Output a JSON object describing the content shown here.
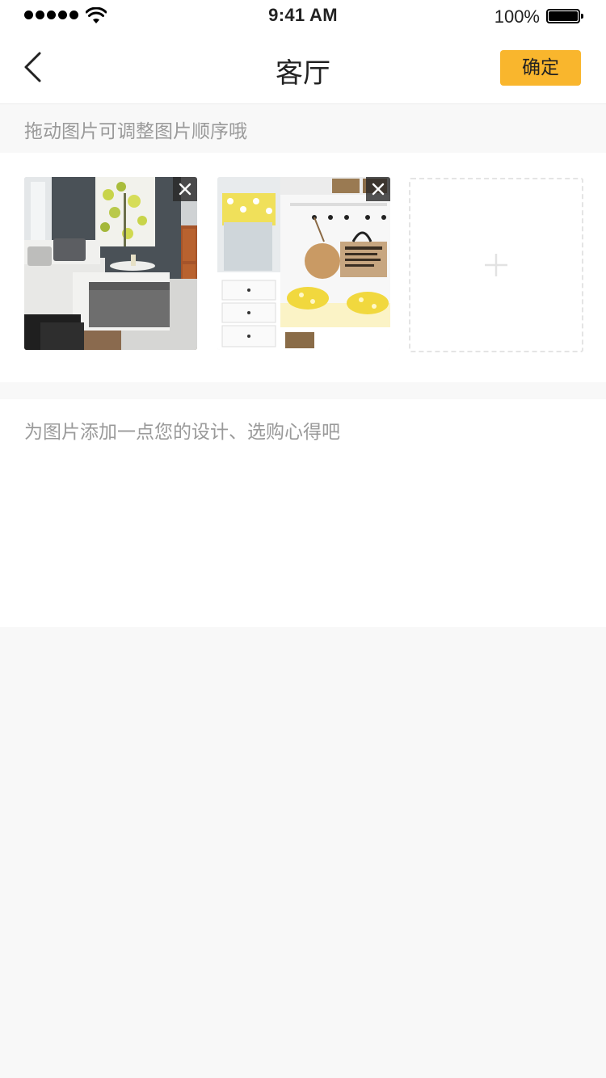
{
  "status_bar": {
    "time": "9:41 AM",
    "battery_percent": "100%",
    "signal_icon": "signal-dots-icon",
    "wifi_icon": "wifi-icon",
    "battery_icon": "battery-icon"
  },
  "nav": {
    "title": "客厅",
    "confirm_label": "确定",
    "back_icon": "chevron-left-icon"
  },
  "hint": {
    "text": "拖动图片可调整图片顺序哦"
  },
  "photos": {
    "items": [
      {
        "subject": "living-room-photo",
        "remove_icon": "close-icon"
      },
      {
        "subject": "entryway-bench-photo",
        "remove_icon": "close-icon"
      }
    ],
    "add_icon": "plus-icon"
  },
  "notes": {
    "placeholder": "为图片添加一点您的设计、选购心得吧",
    "value": ""
  },
  "colors": {
    "accent": "#f9b62d",
    "page_background": "#f8f8f8",
    "hint_text": "#9a9a9a"
  }
}
